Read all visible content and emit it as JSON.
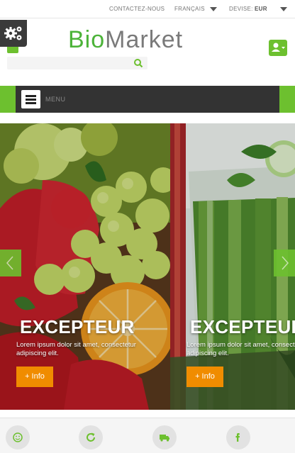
{
  "topbar": {
    "contact": "CONTACTEZ-NOUS",
    "language": "FRANÇAIS",
    "currency_label": "DEVISE:",
    "currency_value": "EUR"
  },
  "logo": {
    "bio": "Bio",
    "market": "Market"
  },
  "search": {
    "placeholder": ""
  },
  "menu": {
    "label": "MENU"
  },
  "slides": [
    {
      "title": "EXCEPTEUR",
      "text": "Lorem ipsum dolor sit amet, consectetur adipiscing elit.",
      "button": "+ Info"
    },
    {
      "title": "EXCEPTEUR",
      "text": "Lorem ipsum dolor sit amet, consectetur adipiscing elit.",
      "button": "+ Info"
    }
  ],
  "colors": {
    "accent": "#6dc02f",
    "button": "#f08c00",
    "dark": "#333333"
  },
  "icons": [
    "gear-icon",
    "user-icon",
    "search-icon",
    "menu-icon",
    "smile-icon",
    "refresh-icon",
    "truck-icon",
    "facebook-icon"
  ]
}
